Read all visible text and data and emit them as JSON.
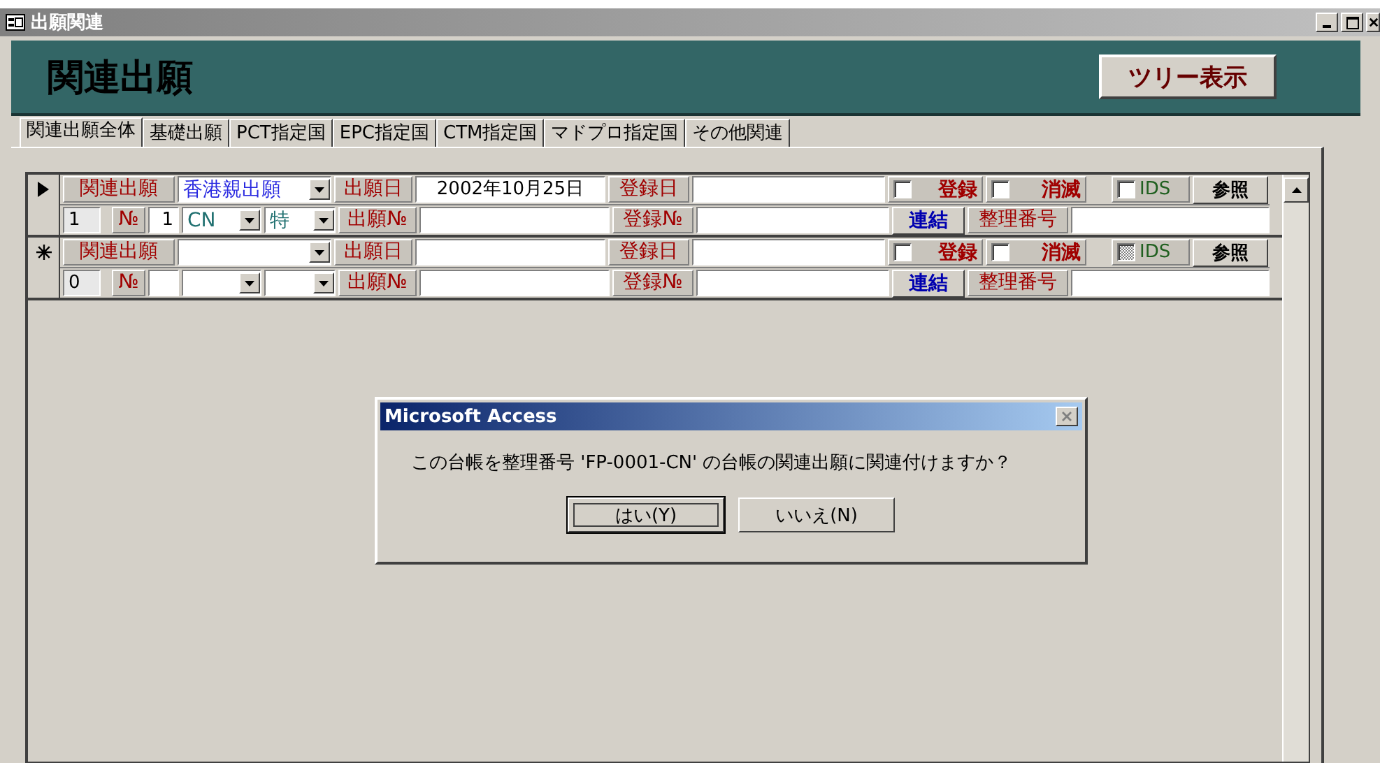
{
  "window": {
    "title": "出願関連"
  },
  "header": {
    "title": "関連出願",
    "tree_button": "ツリー表示"
  },
  "tabs": [
    {
      "label": "関連出願全体",
      "selected": true
    },
    {
      "label": "基礎出願",
      "selected": false
    },
    {
      "label": "PCT指定国",
      "selected": false
    },
    {
      "label": "EPC指定国",
      "selected": false
    },
    {
      "label": "CTM指定国",
      "selected": false
    },
    {
      "label": "マドプロ指定国",
      "selected": false
    },
    {
      "label": "その他関連",
      "selected": false
    }
  ],
  "records": [
    {
      "kind": "current",
      "related_label": "関連出願",
      "relation": "香港親出願",
      "filing_date_label": "出願日",
      "filing_date": "2002年10月25日",
      "reg_date_label": "登録日",
      "registered": {
        "label": "登録",
        "checked": false
      },
      "lapsed": {
        "label": "消滅",
        "checked": false
      },
      "ids": {
        "label": "IDS",
        "indeterminate": false
      },
      "ref_button": "参照",
      "record_no": "1",
      "no_label": "№",
      "number": "1",
      "country": "CN",
      "type": "特",
      "app_no_label": "出願№",
      "reg_no_label": "登録№",
      "link_button": "連結",
      "ref_no_label": "整理番号"
    },
    {
      "kind": "new",
      "related_label": "関連出願",
      "filing_date_label": "出願日",
      "reg_date_label": "登録日",
      "registered": {
        "label": "登録",
        "checked": false
      },
      "lapsed": {
        "label": "消滅",
        "checked": false
      },
      "ids": {
        "label": "IDS",
        "indeterminate": true
      },
      "ref_button": "参照",
      "record_no": "0",
      "no_label": "№",
      "app_no_label": "出願№",
      "reg_no_label": "登録№",
      "link_button": "連結",
      "ref_no_label": "整理番号"
    }
  ],
  "dialog": {
    "title": "Microsoft Access",
    "message": "この台帳を整理番号 'FP-0001-CN' の台帳の関連出願に関連付けますか？",
    "buttons": [
      {
        "label": "はい(Y)",
        "selected": true
      },
      {
        "label": "いいえ(N)",
        "selected": false
      }
    ]
  }
}
